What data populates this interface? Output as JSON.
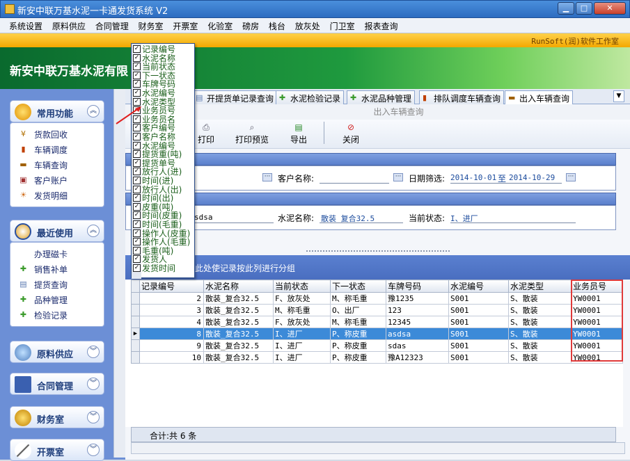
{
  "window": {
    "title": "新安中联万基水泥一卡通发货系统 V2"
  },
  "menu": [
    "系统设置",
    "原料供应",
    "合同管理",
    "财务室",
    "开票室",
    "化验室",
    "磅房",
    "栈台",
    "放灰处",
    "门卫室",
    "报表查询"
  ],
  "credit": "RunSoft(润)软件工作室",
  "banner_title": "新安中联万基水泥有限",
  "sidebar": {
    "groups": [
      {
        "label": "常用功能",
        "items": [
          "货款回收",
          "车辆调度",
          "车辆查询",
          "客户账户",
          "发货明细"
        ]
      },
      {
        "label": "最近使用",
        "items": [
          "办理磁卡",
          "销售补单",
          "提货查询",
          "品种管理",
          "检验记录"
        ]
      },
      {
        "label": "原料供应"
      },
      {
        "label": "合同管理"
      },
      {
        "label": "财务室"
      },
      {
        "label": "开票室"
      }
    ]
  },
  "tabs": [
    "开提货单记录查询",
    "水泥检验记录",
    "水泥品种管理",
    "排队调度车辆查询",
    "出入车辆查询"
  ],
  "query_title": "出入车辆查询",
  "toolbar": {
    "print": "打印",
    "preview": "打印预览",
    "export": "导出",
    "close": "关闭"
  },
  "filter": {
    "customer_label": "客户名称:",
    "date_label": "日期筛选:",
    "date_from": "2014-10-01",
    "date_to_sep": "至",
    "date_to": "2014-10-29",
    "plate_partial": "sdsa",
    "cement_label": "水泥名称:",
    "cement_value": "散装_复合32.5",
    "state_label": "当前状态:",
    "state_value": "I、进厂"
  },
  "group_hint": "此处使记录按此列进行分组",
  "column_chooser": [
    "记录编号",
    "水泥名称",
    "当前状态",
    "下一状态",
    "车牌号码",
    "水泥编号",
    "水泥类型",
    "业务员号",
    "业务员名",
    "客户编号",
    "客户名称",
    "水泥编号",
    "提货重(吨)",
    "提货单号",
    "放行人(进)",
    "时间(进)",
    "放行人(出)",
    "时间(出)",
    "皮重(吨)",
    "时间(皮重)",
    "时间(毛重)",
    "操作人(皮重)",
    "操作人(毛重)",
    "毛重(吨)",
    "发货人",
    "发货时间"
  ],
  "grid": {
    "columns": [
      "记录编号",
      "水泥名称",
      "当前状态",
      "下一状态",
      "车牌号码",
      "水泥编号",
      "水泥类型",
      "业务员号"
    ],
    "rows": [
      [
        "2",
        "散装_复合32.5",
        "F、放灰处",
        "M、称毛重",
        "豫1235",
        "S001",
        "S、散装",
        "YW0001"
      ],
      [
        "3",
        "散装_复合32.5",
        "M、称毛重",
        "O、出厂",
        "123",
        "S001",
        "S、散装",
        "YW0001"
      ],
      [
        "4",
        "散装_复合32.5",
        "F、放灰处",
        "M、称毛重",
        "12345",
        "S001",
        "S、散装",
        "YW0001"
      ],
      [
        "8",
        "散装_复合32.5",
        "I、进厂",
        "P、称皮重",
        "asdsa",
        "S001",
        "S、散装",
        "YW0001"
      ],
      [
        "9",
        "散装_复合32.5",
        "I、进厂",
        "P、称皮重",
        "sdas",
        "S001",
        "S、散装",
        "YW0001"
      ],
      [
        "10",
        "散装_复合32.5",
        "I、进厂",
        "P、称皮重",
        "豫A12323",
        "S001",
        "S、散装",
        "YW0001"
      ]
    ],
    "selected_index": 3
  },
  "footer": "合计:共 6 条",
  "colors": {
    "accent": "#3c8ad8",
    "highlight_border": "#e03a3a"
  }
}
